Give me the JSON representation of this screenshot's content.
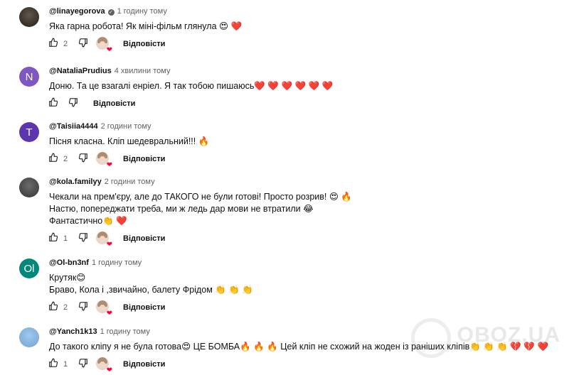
{
  "reply_label": "Відповісти",
  "watermark": "OBOZ.UA",
  "colors": {
    "like_heart": "#ff0033",
    "meta_text": "#606060"
  },
  "comments": [
    {
      "handle": "@linayegorova",
      "verified": true,
      "time": "1 годину тому",
      "lines": [
        "Яка гарна робота! Як міні-фільм глянула 😍 ❤️"
      ],
      "likes": "2",
      "creator_heart": true,
      "avatar_letter": "",
      "avatar_color": "#2b2016"
    },
    {
      "handle": "@NataliaPrudius",
      "verified": false,
      "time": "4 хвилини тому",
      "lines": [
        "Доню. Та це взагалі енріел. Я так тобою пишаюсь❤️ ❤️ ❤️ ❤️ ❤️ ❤️"
      ],
      "likes": "",
      "creator_heart": false,
      "avatar_letter": "N",
      "avatar_color": "#7e57c2"
    },
    {
      "handle": "@Taisiia4444",
      "verified": false,
      "time": "2 години тому",
      "lines": [
        "Пісня класна. Кліп шедевральний!!! 🔥"
      ],
      "likes": "2",
      "creator_heart": true,
      "avatar_letter": "T",
      "avatar_color": "#5e35b1"
    },
    {
      "handle": "@kola.familyy",
      "verified": false,
      "time": "2 години тому",
      "lines": [
        "Чекали на прем'єру, але до ТАКОГО не були готові! Просто розрив! 😍 🔥",
        "Настю, попереджати треба, ми ж ледь дар мови не втратили 😂",
        "Фантастично👏 ❤️"
      ],
      "likes": "1",
      "creator_heart": true,
      "avatar_letter": "",
      "avatar_color": "#3a3a3a"
    },
    {
      "handle": "@Ol-bn3nf",
      "verified": false,
      "time": "1 годину тому",
      "lines": [
        "Крутяк😊",
        "Браво, Кола і ,звичайно, балету Фрідом 👏 👏 👏"
      ],
      "likes": "2",
      "creator_heart": true,
      "avatar_letter": "Ol",
      "avatar_color": "#00897b"
    },
    {
      "handle": "@Yanch1k13",
      "verified": false,
      "time": "1 годину тому",
      "lines": [
        "До такого кліпу я не була готова😍 ЦЕ БОМБА🔥 🔥 🔥 Цей кліп не схожий на жоден із раніших кліпів👏 👏 👏 💔 💔 ❤️"
      ],
      "likes": "1",
      "creator_heart": true,
      "avatar_letter": "",
      "avatar_color": "#7fb6e8"
    }
  ]
}
